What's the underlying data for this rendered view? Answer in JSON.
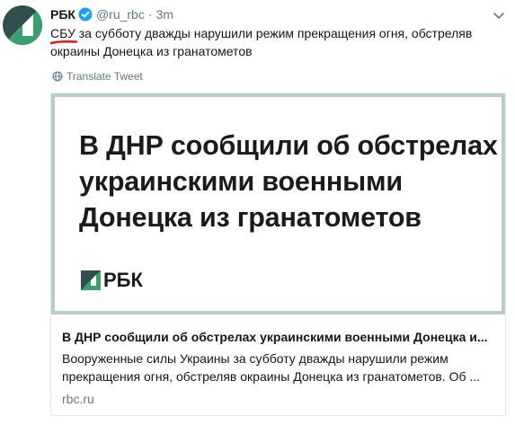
{
  "tweet": {
    "author_name": "РБК",
    "handle": "@ru_rbc",
    "separator": "·",
    "time": "3m",
    "text": "СБУ за субботу дважды нарушили режим прекращения огня, обстреляв окраины Донецка из гранатометов",
    "translate_label": "Translate Tweet",
    "avatar_icon": "rbc-logo-icon",
    "verified_icon": "verified-badge-icon",
    "menu_icon": "chevron-down-icon"
  },
  "card": {
    "image_headline": "В ДНР сообщили об обстрелах украинскими военными Донецка из гранатометов",
    "image_logo_text": "РБК",
    "title": "В ДНР сообщили об обстрелах украинскими военными Донецка и...",
    "description": "Вооруженные силы Украины за субботу дважды нарушили режим прекращения огня, обстреляв окраины Донецка из гранатометов. Об ...",
    "domain": "rbc.ru"
  },
  "colors": {
    "brand_dark": "#2f4f4f",
    "brand_green": "#3a9f6e",
    "verified_blue": "#1da1f2",
    "annotation_red": "#e0191d",
    "card_image_border": "#b6d0c3",
    "muted_text": "#657786"
  }
}
